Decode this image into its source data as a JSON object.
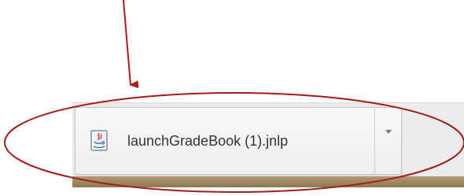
{
  "download_shelf": {
    "item": {
      "file_name": "launchGradeBook (1).jnlp",
      "file_icon": "java-icon",
      "menu_icon": "chevron-down-icon"
    }
  },
  "annotations": {
    "arrow_color": "#b01c1c",
    "ellipse_color": "#a31b1b"
  }
}
